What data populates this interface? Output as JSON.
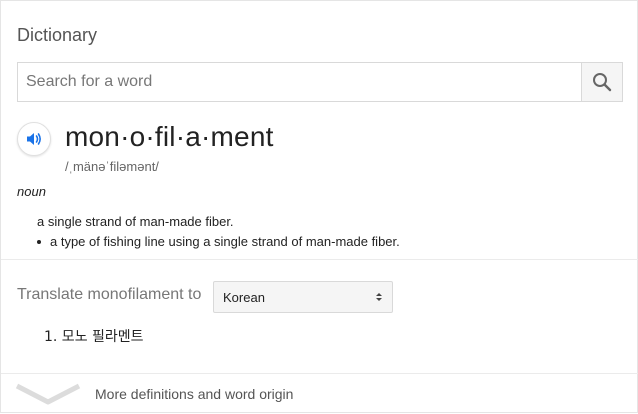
{
  "title": "Dictionary",
  "search": {
    "placeholder": "Search for a word"
  },
  "entry": {
    "headword": "mon·o·fil·a·ment",
    "phonetic": "/ˌmänəˈfiləmənt/",
    "part_of_speech": "noun",
    "definition": "a single strand of man-made fiber.",
    "sub_definitions": [
      "a type of fishing line using a single strand of man-made fiber."
    ]
  },
  "translate": {
    "label": "Translate monofilament to",
    "selected_language": "Korean",
    "results": [
      "1. 모노 필라멘트"
    ]
  },
  "footer": {
    "more_label": "More definitions and word origin"
  },
  "colors": {
    "accent": "#1a73e8",
    "muted_text": "#777777",
    "border": "#d9d9d9"
  },
  "icons": {
    "search": "search-icon",
    "speaker": "speaker-icon",
    "select": "select-arrows-icon",
    "expand": "chevron-down-icon"
  }
}
